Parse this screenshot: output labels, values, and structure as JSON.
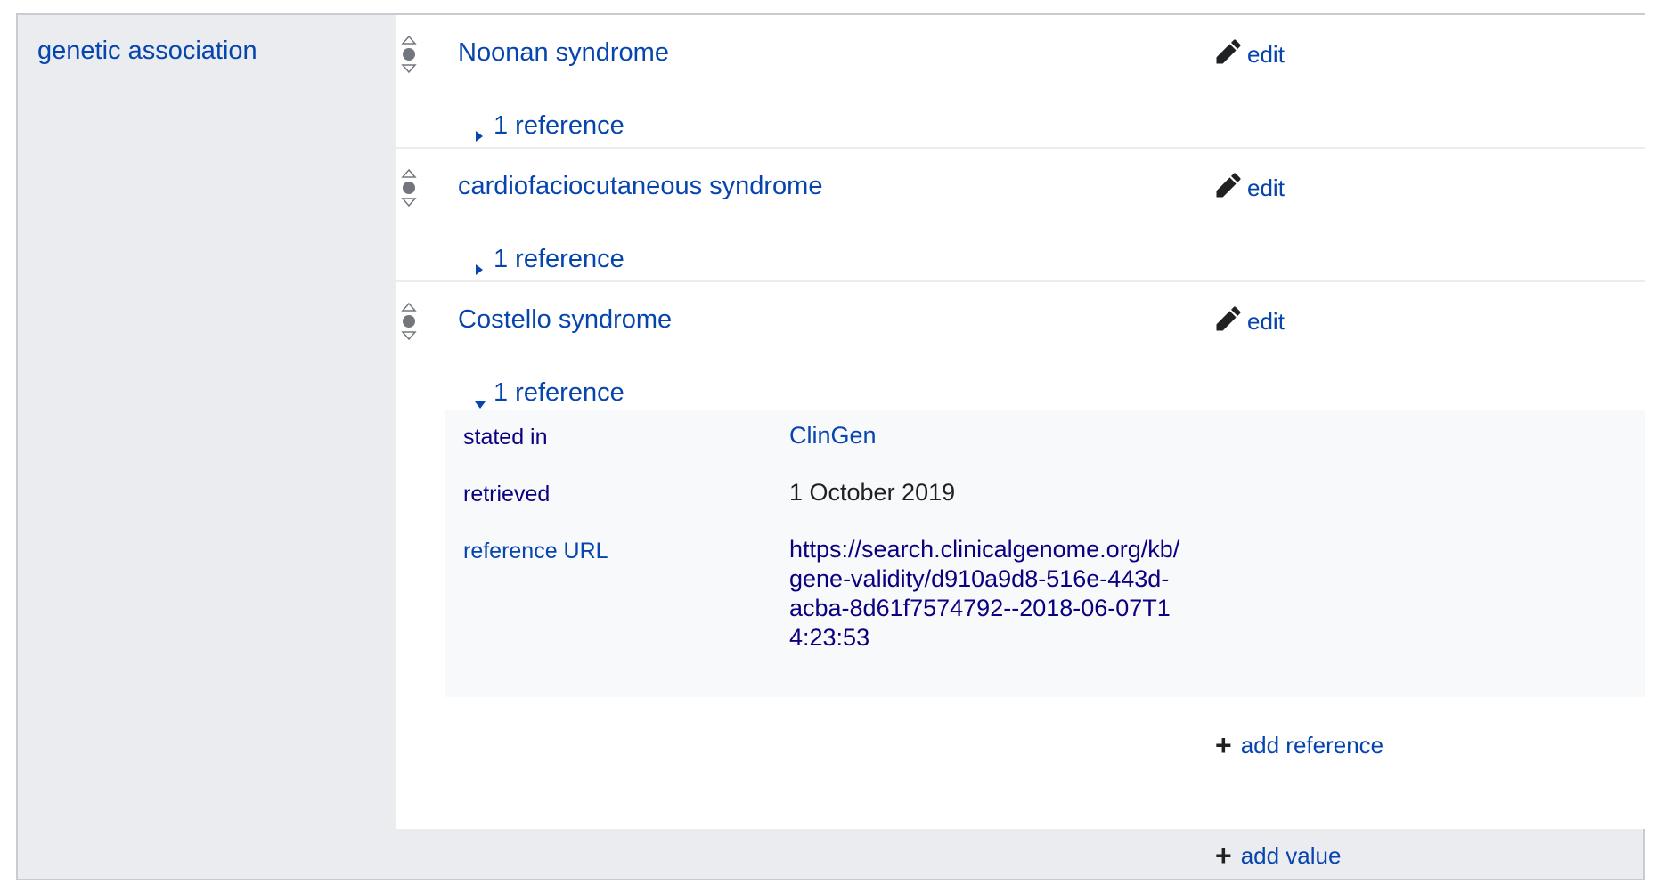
{
  "property": {
    "label": "genetic association"
  },
  "statements": [
    {
      "value": "Noonan syndrome",
      "edit_label": "edit",
      "reference_toggle": "1 reference",
      "expanded": false
    },
    {
      "value": "cardiofaciocutaneous syndrome",
      "edit_label": "edit",
      "reference_toggle": "1 reference",
      "expanded": false
    },
    {
      "value": "Costello syndrome",
      "edit_label": "edit",
      "reference_toggle": "1 reference",
      "expanded": true,
      "references": [
        {
          "property": "stated in",
          "value": "ClinGen"
        },
        {
          "property": "retrieved",
          "value": "1 October 2019"
        },
        {
          "property": "reference URL",
          "value": "https://search.clinicalgenome.org/kb/gene-validity/d910a9d8-516e-443d-acba-8d61f7574792--2018-06-07T14:23:53"
        }
      ],
      "add_reference_label": "add reference"
    }
  ],
  "add_value_label": "add value",
  "colors": {
    "link": "#0645ad",
    "link_visited": "#0b0080",
    "border": "#c8ccd1",
    "label_bg": "#eaecf0",
    "reference_bg": "#f8f9fa"
  },
  "icons": {
    "rank": "rank-normal-icon",
    "edit": "pencil-icon",
    "expand": "triangle-right-icon",
    "collapse": "triangle-down-icon",
    "add": "plus-icon"
  }
}
